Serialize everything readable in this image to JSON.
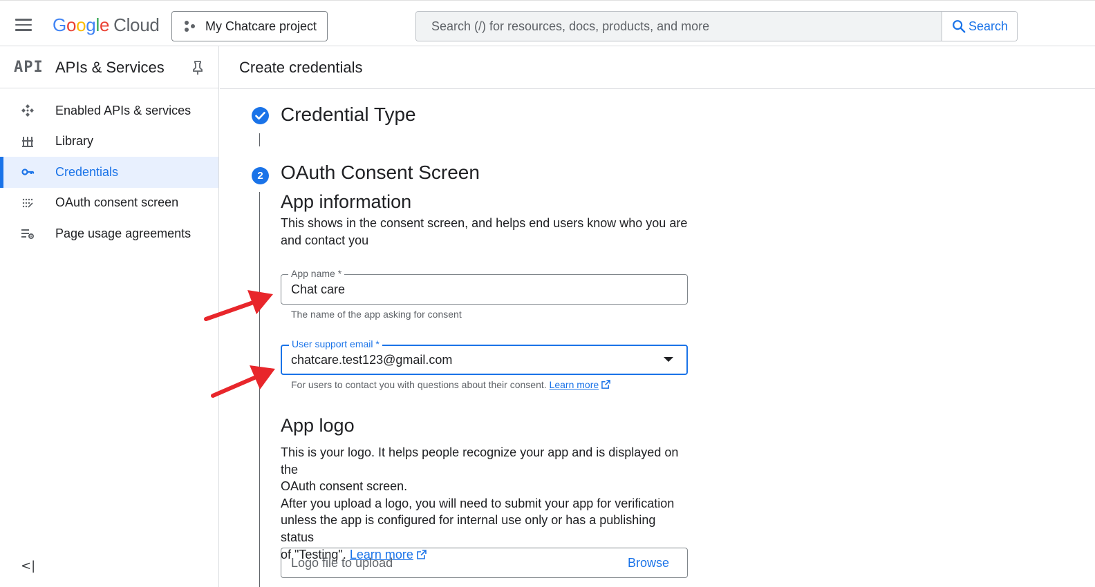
{
  "topbar": {
    "logo_google": [
      "G",
      "o",
      "o",
      "g",
      "l",
      "e"
    ],
    "logo_cloud": "Cloud",
    "project_label": "My Chatcare project",
    "search_placeholder": "Search (/) for resources, docs, products, and more",
    "search_button": "Search"
  },
  "sidebar": {
    "api_glyph": "API",
    "title": "APIs & Services",
    "items": [
      {
        "label": "Enabled APIs & services",
        "icon": "enabled-apis-icon"
      },
      {
        "label": "Library",
        "icon": "library-icon"
      },
      {
        "label": "Credentials",
        "icon": "key-icon",
        "active": true
      },
      {
        "label": "OAuth consent screen",
        "icon": "oauth-consent-icon"
      },
      {
        "label": "Page usage agreements",
        "icon": "usage-agreements-icon"
      }
    ],
    "collapse_glyph": "<|"
  },
  "main": {
    "page_title": "Create credentials",
    "steps": [
      {
        "title": "Credential Type",
        "state": "complete"
      },
      {
        "number": "2",
        "title": "OAuth Consent Screen",
        "state": "active"
      }
    ],
    "app_info": {
      "heading": "App information",
      "description_line1": "This shows in the consent screen, and helps end users know who you are",
      "description_line2": "and contact you",
      "app_name_label": "App name *",
      "app_name_value": "Chat care",
      "app_name_helper": "The name of the app asking for consent",
      "email_label": "User support email *",
      "email_value": "chatcare.test123@gmail.com",
      "email_helper": "For users to contact you with questions about their consent.",
      "email_helper_link": "Learn more"
    },
    "app_logo": {
      "heading": "App logo",
      "line1": "This is your logo. It helps people recognize your app and is displayed on the",
      "line2": "OAuth consent screen.",
      "line3": "After you upload a logo, you will need to submit your app for verification",
      "line4": "unless the app is configured for internal use only or has a publishing status",
      "line5": "of \"Testing\".",
      "link": "Learn more",
      "upload_placeholder": "Logo file to upload",
      "browse": "Browse"
    }
  },
  "colors": {
    "accent": "#1a73e8",
    "arrow": "#e8262b",
    "active_nav_bg": "#e8f0fe"
  }
}
